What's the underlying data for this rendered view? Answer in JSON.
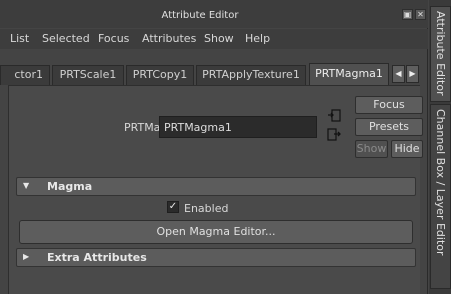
{
  "window": {
    "title": "Attribute Editor"
  },
  "menu": [
    "List",
    "Selected",
    "Focus",
    "Attributes",
    "Show",
    "Help"
  ],
  "tabs": [
    {
      "label": "ctor1",
      "active": false
    },
    {
      "label": "PRTScale1",
      "active": false
    },
    {
      "label": "PRTCopy1",
      "active": false
    },
    {
      "label": "PRTApplyTexture1",
      "active": false
    },
    {
      "label": "PRTMagma1",
      "active": true
    }
  ],
  "node": {
    "label": "PRTMagma:",
    "value": "PRTMagma1"
  },
  "buttons": {
    "focus": "Focus",
    "presets": "Presets",
    "show": "Show",
    "hide": "Hide"
  },
  "sections": [
    {
      "label": "Magma",
      "expanded": true
    },
    {
      "label": "Extra Attributes",
      "expanded": false
    }
  ],
  "enabled": {
    "label": "Enabled",
    "checked": true
  },
  "open_editor_label": "Open Magma Editor...",
  "side_tabs": [
    "Attribute Editor",
    "Channel Box / Layer Editor"
  ],
  "icons": {
    "float": "float-window-icon",
    "close": "close-icon",
    "prev": "tab-left-arrow-icon",
    "next": "tab-right-arrow-icon",
    "input_conn": "input-connection-icon",
    "output_conn": "output-connection-icon"
  }
}
